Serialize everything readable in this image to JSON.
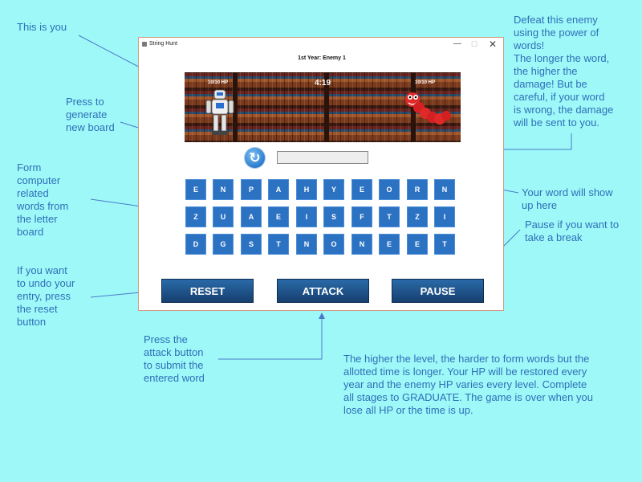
{
  "window": {
    "title": "String Hunt",
    "minimize": "—",
    "maximize": "☐",
    "close": "✕"
  },
  "game": {
    "stage": "1st Year: Enemy 1",
    "player_hp": "10/10 HP",
    "enemy_hp": "10/10 HP",
    "timer": "4:19",
    "current_word": "",
    "refresh_icon": "refresh-icon",
    "board": [
      [
        "E",
        "N",
        "P",
        "A",
        "H",
        "Y",
        "E",
        "O",
        "R",
        "N"
      ],
      [
        "Z",
        "U",
        "A",
        "E",
        "I",
        "S",
        "F",
        "T",
        "Z",
        "I"
      ],
      [
        "D",
        "G",
        "S",
        "T",
        "N",
        "O",
        "N",
        "E",
        "E",
        "T"
      ]
    ],
    "buttons": {
      "reset": "RESET",
      "attack": "ATTACK",
      "pause": "PAUSE"
    }
  },
  "annotations": {
    "you": "This is you",
    "enemy": "Defeat this enemy\nusing the power of\nwords!\nThe longer the word,\nthe higher the\ndamage! But be\ncareful, if your word\nis wrong, the damage\nwill be sent to you.",
    "refresh": "Press to\ngenerate\nnew board",
    "form": "Form\ncomputer\nrelated\nwords from\nthe letter\nboard",
    "word": "Your word will show\nup here",
    "pause": "Pause if you want to\ntake a break",
    "reset": "If you want\nto undo your\nentry, press\nthe reset\nbutton",
    "attack": "Press the\nattack button\nto submit the\nentered word",
    "levels": "The higher the level, the harder to form words but the\nallotted time is longer. Your HP will be restored every\nyear and the enemy HP varies every level. Complete\nall stages to GRADUATE. The game is over when you\nlose all HP or the time is up."
  },
  "colors": {
    "background": "#9ef8f8",
    "annotation_text": "#2e6fb8",
    "tile": "#2c72c3",
    "button": "#1d4f86"
  }
}
